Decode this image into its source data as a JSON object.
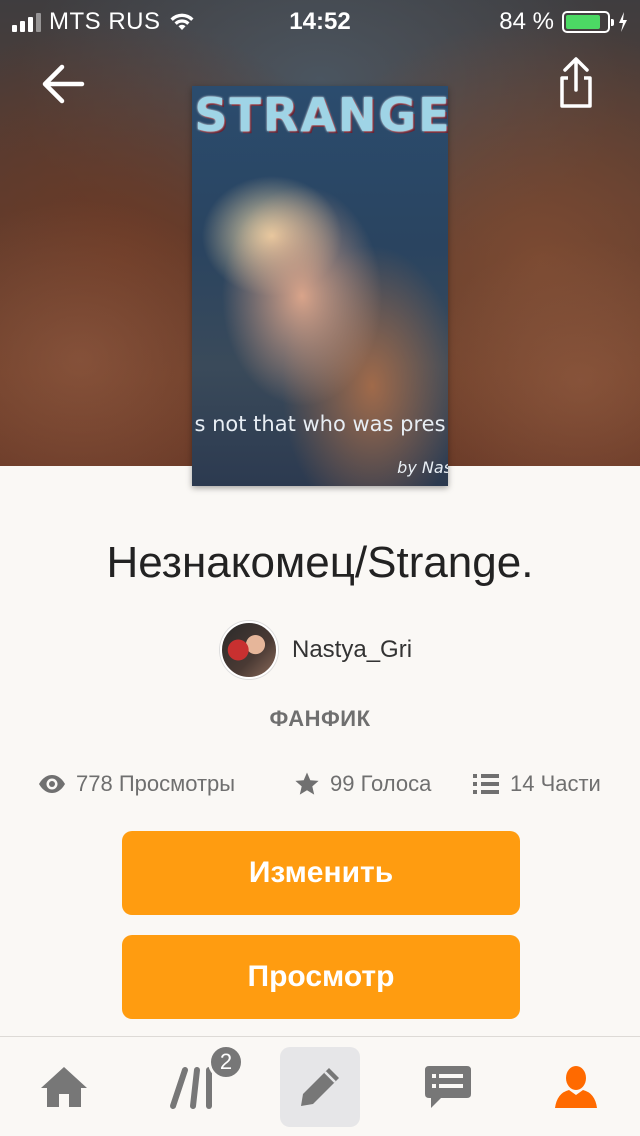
{
  "status_bar": {
    "carrier": "MTS RUS",
    "time": "14:52",
    "battery_percent": "84 %",
    "battery_level": 0.84
  },
  "header": {
    "back_icon": "arrow-left-icon",
    "share_icon": "share-icon"
  },
  "cover": {
    "title_text": "STRANGE",
    "subtitle_text": "s not that who was pres",
    "byline_text": "by Nas"
  },
  "story": {
    "title": "Незнакомец/Strange.",
    "author_name": "Nastya_Gri",
    "category": "ФАНФИК"
  },
  "stats": {
    "views": "778 Просмотры",
    "votes": "99 Голоса",
    "parts": "14 Части"
  },
  "actions": {
    "edit_label": "Изменить",
    "view_label": "Просмотр",
    "accent_color": "#ff9c10"
  },
  "tabbar": {
    "library_badge": "2",
    "active_color": "#ff6a00",
    "inactive_color": "#777777",
    "items": [
      "home-icon",
      "library-icon",
      "write-icon",
      "messages-icon",
      "profile-icon"
    ]
  }
}
